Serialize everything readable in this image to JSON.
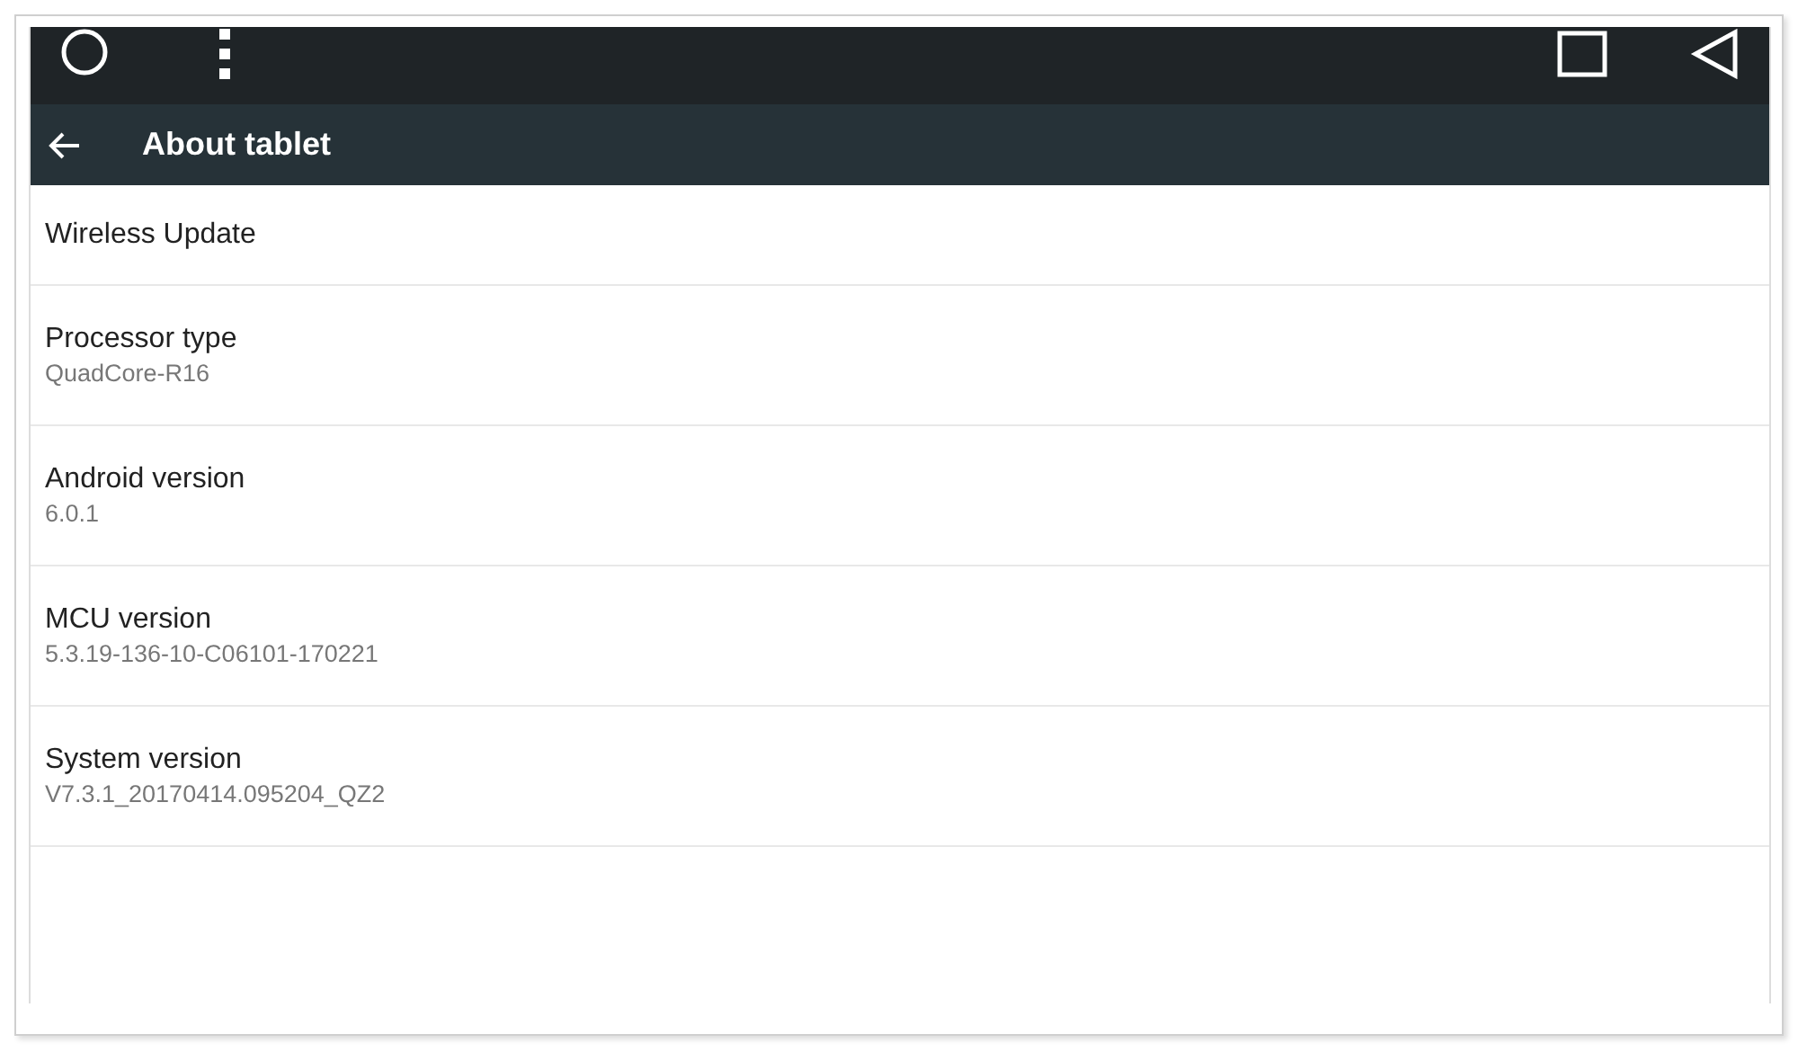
{
  "toolbar": {
    "title": "About tablet"
  },
  "items": [
    {
      "title": "Wireless Update"
    },
    {
      "title": "Processor type",
      "summary": "QuadCore-R16"
    },
    {
      "title": "Android version",
      "summary": "6.0.1"
    },
    {
      "title": "MCU version",
      "summary": "5.3.19-136-10-C06101-170221"
    },
    {
      "title": "System version",
      "summary": "V7.3.1_20170414.095204_QZ2"
    }
  ]
}
